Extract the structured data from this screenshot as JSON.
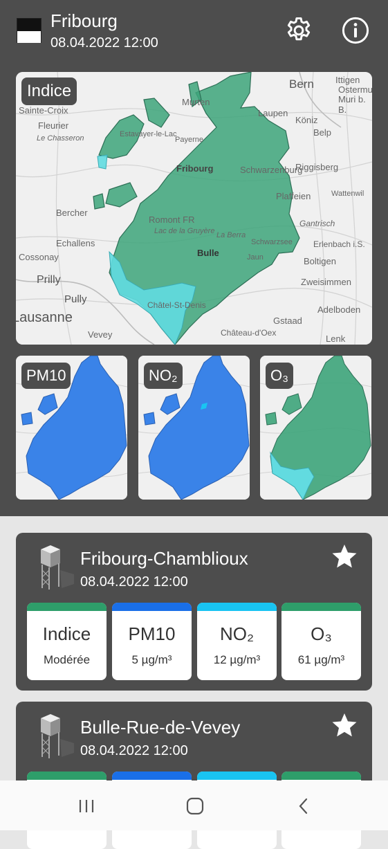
{
  "header": {
    "title": "Fribourg",
    "datetime": "08.04.2022 12:00",
    "flag_icon": "fribourg-flag-icon",
    "settings_icon": "gear-icon",
    "info_icon": "info-icon"
  },
  "maps": {
    "main": {
      "label": "Indice",
      "place_names": [
        "Bern",
        "Ittigen",
        "Ostermundigen",
        "Muri b. B.",
        "Laupen",
        "Köniz",
        "Belp",
        "Murten",
        "Fleurier",
        "Sainte-Croix",
        "Le Chasseron",
        "Fribourg",
        "Schwarzenburg",
        "Riggisberg",
        "Plaffeien",
        "Wattenwil",
        "Bercher",
        "Romont FR",
        "Lac de la Gruyère",
        "Gantrisch",
        "Echallens",
        "La Berra",
        "Erlenbach i.S.",
        "Cossonay",
        "Bulle",
        "Schwarzsee",
        "Boltigen",
        "Jaun",
        "Prilly",
        "Zweisimmen",
        "Pully",
        "Châtel-St-Denis",
        "Adelboden",
        "Lausanne",
        "Gstaad",
        "Vevey",
        "Château-d'Oex",
        "Lenk",
        "Payerne",
        "Estavayer-le-Lac"
      ]
    },
    "small": [
      {
        "label": "PM10"
      },
      {
        "label": "NO₂"
      },
      {
        "label": "O₃"
      }
    ]
  },
  "colors": {
    "index_moderate": "#3da47a",
    "index_good": "#62dbe0",
    "pm_no2": "#3a83e8",
    "bar_index": "#2e9e6a",
    "bar_pm10": "#1a6fe8",
    "bar_no2": "#19c4f2",
    "bar_o3": "#2e9e6a"
  },
  "stations": [
    {
      "name": "Fribourg-Chamblioux",
      "datetime": "08.04.2022 12:00",
      "icon": "station-tower-icon",
      "favorite_icon": "star-icon",
      "cards": [
        {
          "name": "Indice",
          "value": "Modérée"
        },
        {
          "name": "PM10",
          "value": "5 µg/m³"
        },
        {
          "name": "NO₂",
          "value": "12 µg/m³"
        },
        {
          "name": "O₃",
          "value": "61 µg/m³"
        }
      ]
    },
    {
      "name": "Bulle-Rue-de-Vevey",
      "datetime": "08.04.2022 12:00",
      "icon": "station-tower-icon",
      "favorite_icon": "star-icon"
    }
  ],
  "navbar": {
    "recent_icon": "recent-apps-icon",
    "home_icon": "home-icon",
    "back_icon": "back-icon"
  }
}
